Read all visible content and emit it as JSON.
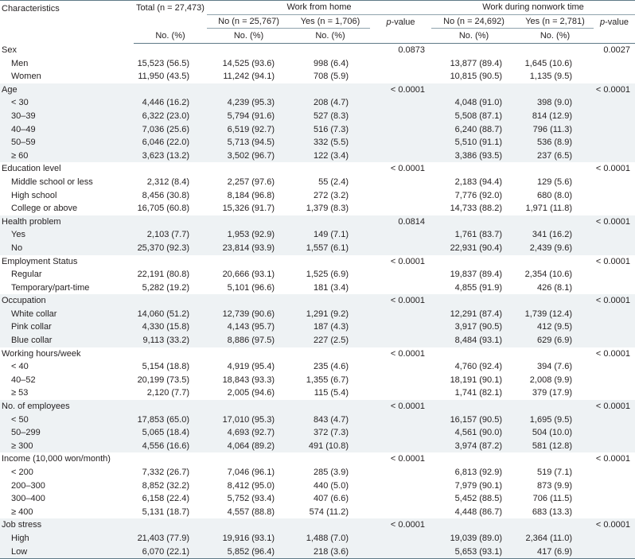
{
  "table": {
    "header": {
      "characteristics": "Characteristics",
      "total": "Total (n = 27,473)",
      "group_wfh": "Work from home",
      "group_wnt": "Work during nonwork time",
      "wfh_no": "No (n = 25,767)",
      "wfh_yes": "Yes (n = 1,706)",
      "wnt_no": "No (n = 24,692)",
      "wnt_yes": "Yes (n = 2,781)",
      "pvalue_1_prefix": "p",
      "pvalue_1_suffix": "-value",
      "pvalue_2_prefix": "p",
      "pvalue_2_suffix": "-value",
      "unit_total": "No. (%)",
      "unit_wfh_no": "No. (%)",
      "unit_wfh_yes": "No. (%)",
      "unit_wnt_no": "No. (%)",
      "unit_wnt_yes": "No. (%)"
    },
    "rows": [
      {
        "type": "group",
        "shaded": false,
        "label": "Sex",
        "total": "",
        "wfh_no": "",
        "wfh_yes": "",
        "p1": "0.0873",
        "wnt_no": "",
        "wnt_yes": "",
        "p2": "0.0027"
      },
      {
        "type": "item",
        "shaded": false,
        "label": "Men",
        "total": "15,523 (56.5)",
        "wfh_no": "14,525 (93.6)",
        "wfh_yes": "998 (6.4)",
        "p1": "",
        "wnt_no": "13,877 (89.4)",
        "wnt_yes": "1,645 (10.6)",
        "p2": ""
      },
      {
        "type": "item",
        "shaded": false,
        "label": "Women",
        "total": "11,950 (43.5)",
        "wfh_no": "11,242 (94.1)",
        "wfh_yes": "708 (5.9)",
        "p1": "",
        "wnt_no": "10,815 (90.5)",
        "wnt_yes": "1,135 (9.5)",
        "p2": ""
      },
      {
        "type": "group",
        "shaded": true,
        "label": "Age",
        "total": "",
        "wfh_no": "",
        "wfh_yes": "",
        "p1": "< 0.0001",
        "wnt_no": "",
        "wnt_yes": "",
        "p2": "< 0.0001"
      },
      {
        "type": "item",
        "shaded": true,
        "label": "< 30",
        "total": "4,446 (16.2)",
        "wfh_no": "4,239 (95.3)",
        "wfh_yes": "208 (4.7)",
        "p1": "",
        "wnt_no": "4,048 (91.0)",
        "wnt_yes": "398 (9.0)",
        "p2": ""
      },
      {
        "type": "item",
        "shaded": true,
        "label": "30–39",
        "total": "6,322 (23.0)",
        "wfh_no": "5,794 (91.6)",
        "wfh_yes": "527 (8.3)",
        "p1": "",
        "wnt_no": "5,508 (87.1)",
        "wnt_yes": "814 (12.9)",
        "p2": ""
      },
      {
        "type": "item",
        "shaded": true,
        "label": "40–49",
        "total": "7,036 (25.6)",
        "wfh_no": "6,519 (92.7)",
        "wfh_yes": "516 (7.3)",
        "p1": "",
        "wnt_no": "6,240 (88.7)",
        "wnt_yes": "796 (11.3)",
        "p2": ""
      },
      {
        "type": "item",
        "shaded": true,
        "label": "50–59",
        "total": "6,046 (22.0)",
        "wfh_no": "5,713 (94.5)",
        "wfh_yes": "332 (5.5)",
        "p1": "",
        "wnt_no": "5,510 (91.1)",
        "wnt_yes": "536 (8.9)",
        "p2": ""
      },
      {
        "type": "item",
        "shaded": true,
        "label": "≥ 60",
        "total": "3,623 (13.2)",
        "wfh_no": "3,502 (96.7)",
        "wfh_yes": "122 (3.4)",
        "p1": "",
        "wnt_no": "3,386 (93.5)",
        "wnt_yes": "237 (6.5)",
        "p2": ""
      },
      {
        "type": "group",
        "shaded": false,
        "label": "Education level",
        "total": "",
        "wfh_no": "",
        "wfh_yes": "",
        "p1": "< 0.0001",
        "wnt_no": "",
        "wnt_yes": "",
        "p2": "< 0.0001"
      },
      {
        "type": "item",
        "shaded": false,
        "label": "Middle school or less",
        "total": "2,312 (8.4)",
        "wfh_no": "2,257 (97.6)",
        "wfh_yes": "55 (2.4)",
        "p1": "",
        "wnt_no": "2,183 (94.4)",
        "wnt_yes": "129 (5.6)",
        "p2": ""
      },
      {
        "type": "item",
        "shaded": false,
        "label": "High school",
        "total": "8,456 (30.8)",
        "wfh_no": "8,184 (96.8)",
        "wfh_yes": "272 (3.2)",
        "p1": "",
        "wnt_no": "7,776 (92.0)",
        "wnt_yes": "680 (8.0)",
        "p2": ""
      },
      {
        "type": "item",
        "shaded": false,
        "label": "College or above",
        "total": "16,705 (60.8)",
        "wfh_no": "15,326 (91.7)",
        "wfh_yes": "1,379 (8.3)",
        "p1": "",
        "wnt_no": "14,733 (88.2)",
        "wnt_yes": "1,971 (11.8)",
        "p2": ""
      },
      {
        "type": "group",
        "shaded": true,
        "label": "Health problem",
        "total": "",
        "wfh_no": "",
        "wfh_yes": "",
        "p1": "0.0814",
        "wnt_no": "",
        "wnt_yes": "",
        "p2": "< 0.0001"
      },
      {
        "type": "item",
        "shaded": true,
        "label": "Yes",
        "total": "2,103 (7.7)",
        "wfh_no": "1,953 (92.9)",
        "wfh_yes": "149 (7.1)",
        "p1": "",
        "wnt_no": "1,761 (83.7)",
        "wnt_yes": "341 (16.2)",
        "p2": ""
      },
      {
        "type": "item",
        "shaded": true,
        "label": "No",
        "total": "25,370 (92.3)",
        "wfh_no": "23,814 (93.9)",
        "wfh_yes": "1,557 (6.1)",
        "p1": "",
        "wnt_no": "22,931 (90.4)",
        "wnt_yes": "2,439 (9.6)",
        "p2": ""
      },
      {
        "type": "group",
        "shaded": false,
        "label": "Employment Status",
        "total": "",
        "wfh_no": "",
        "wfh_yes": "",
        "p1": "< 0.0001",
        "wnt_no": "",
        "wnt_yes": "",
        "p2": "< 0.0001"
      },
      {
        "type": "item",
        "shaded": false,
        "label": "Regular",
        "total": "22,191 (80.8)",
        "wfh_no": "20,666 (93.1)",
        "wfh_yes": "1,525 (6.9)",
        "p1": "",
        "wnt_no": "19,837 (89.4)",
        "wnt_yes": "2,354 (10.6)",
        "p2": ""
      },
      {
        "type": "item",
        "shaded": false,
        "label": "Temporary/part-time",
        "total": "5,282 (19.2)",
        "wfh_no": "5,101 (96.6)",
        "wfh_yes": "181 (3.4)",
        "p1": "",
        "wnt_no": "4,855 (91.9)",
        "wnt_yes": "426 (8.1)",
        "p2": ""
      },
      {
        "type": "group",
        "shaded": true,
        "label": "Occupation",
        "total": "",
        "wfh_no": "",
        "wfh_yes": "",
        "p1": "< 0.0001",
        "wnt_no": "",
        "wnt_yes": "",
        "p2": "< 0.0001"
      },
      {
        "type": "item",
        "shaded": true,
        "label": "White collar",
        "total": "14,060 (51.2)",
        "wfh_no": "12,739 (90.6)",
        "wfh_yes": "1,291 (9.2)",
        "p1": "",
        "wnt_no": "12,291 (87.4)",
        "wnt_yes": "1,739 (12.4)",
        "p2": ""
      },
      {
        "type": "item",
        "shaded": true,
        "label": "Pink collar",
        "total": "4,330 (15.8)",
        "wfh_no": "4,143 (95.7)",
        "wfh_yes": "187 (4.3)",
        "p1": "",
        "wnt_no": "3,917 (90.5)",
        "wnt_yes": "412 (9.5)",
        "p2": ""
      },
      {
        "type": "item",
        "shaded": true,
        "label": "Blue collar",
        "total": "9,113 (33.2)",
        "wfh_no": "8,886 (97.5)",
        "wfh_yes": "227 (2.5)",
        "p1": "",
        "wnt_no": "8,484 (93.1)",
        "wnt_yes": "629 (6.9)",
        "p2": ""
      },
      {
        "type": "group",
        "shaded": false,
        "label": "Working hours/week",
        "total": "",
        "wfh_no": "",
        "wfh_yes": "",
        "p1": "< 0.0001",
        "wnt_no": "",
        "wnt_yes": "",
        "p2": "< 0.0001"
      },
      {
        "type": "item",
        "shaded": false,
        "label": "< 40",
        "total": "5,154 (18.8)",
        "wfh_no": "4,919 (95.4)",
        "wfh_yes": "235 (4.6)",
        "p1": "",
        "wnt_no": "4,760 (92.4)",
        "wnt_yes": "394 (7.6)",
        "p2": ""
      },
      {
        "type": "item",
        "shaded": false,
        "label": "40–52",
        "total": "20,199 (73.5)",
        "wfh_no": "18,843 (93.3)",
        "wfh_yes": "1,355 (6.7)",
        "p1": "",
        "wnt_no": "18,191 (90.1)",
        "wnt_yes": "2,008 (9.9)",
        "p2": ""
      },
      {
        "type": "item",
        "shaded": false,
        "label": "≥ 53",
        "total": "2,120 (7.7)",
        "wfh_no": "2,005 (94.6)",
        "wfh_yes": "115 (5.4)",
        "p1": "",
        "wnt_no": "1,741 (82.1)",
        "wnt_yes": "379 (17.9)",
        "p2": ""
      },
      {
        "type": "group",
        "shaded": true,
        "label": "No. of employees",
        "total": "",
        "wfh_no": "",
        "wfh_yes": "",
        "p1": "< 0.0001",
        "wnt_no": "",
        "wnt_yes": "",
        "p2": "< 0.0001"
      },
      {
        "type": "item",
        "shaded": true,
        "label": "< 50",
        "total": "17,853 (65.0)",
        "wfh_no": "17,010 (95.3)",
        "wfh_yes": "843 (4.7)",
        "p1": "",
        "wnt_no": "16,157 (90.5)",
        "wnt_yes": "1,695 (9.5)",
        "p2": ""
      },
      {
        "type": "item",
        "shaded": true,
        "label": "50–299",
        "total": "5,065 (18.4)",
        "wfh_no": "4,693 (92.7)",
        "wfh_yes": "372 (7.3)",
        "p1": "",
        "wnt_no": "4,561 (90.0)",
        "wnt_yes": "504 (10.0)",
        "p2": ""
      },
      {
        "type": "item",
        "shaded": true,
        "label": "≥ 300",
        "total": "4,556 (16.6)",
        "wfh_no": "4,064 (89.2)",
        "wfh_yes": "491 (10.8)",
        "p1": "",
        "wnt_no": "3,974 (87.2)",
        "wnt_yes": "581 (12.8)",
        "p2": ""
      },
      {
        "type": "group",
        "shaded": false,
        "label": "Income (10,000 won/month)",
        "total": "",
        "wfh_no": "",
        "wfh_yes": "",
        "p1": "< 0.0001",
        "wnt_no": "",
        "wnt_yes": "",
        "p2": "< 0.0001"
      },
      {
        "type": "item",
        "shaded": false,
        "label": "< 200",
        "total": "7,332 (26.7)",
        "wfh_no": "7,046 (96.1)",
        "wfh_yes": "285 (3.9)",
        "p1": "",
        "wnt_no": "6,813 (92.9)",
        "wnt_yes": "519 (7.1)",
        "p2": ""
      },
      {
        "type": "item",
        "shaded": false,
        "label": "200–300",
        "total": "8,852 (32.2)",
        "wfh_no": "8,412 (95.0)",
        "wfh_yes": "440 (5.0)",
        "p1": "",
        "wnt_no": "7,979 (90.1)",
        "wnt_yes": "873 (9.9)",
        "p2": ""
      },
      {
        "type": "item",
        "shaded": false,
        "label": "300–400",
        "total": "6,158 (22.4)",
        "wfh_no": "5,752 (93.4)",
        "wfh_yes": "407 (6.6)",
        "p1": "",
        "wnt_no": "5,452 (88.5)",
        "wnt_yes": "706 (11.5)",
        "p2": ""
      },
      {
        "type": "item",
        "shaded": false,
        "label": "≥ 400",
        "total": "5,131 (18.7)",
        "wfh_no": "4,557 (88.8)",
        "wfh_yes": "574 (11.2)",
        "p1": "",
        "wnt_no": "4,448 (86.7)",
        "wnt_yes": "683 (13.3)",
        "p2": ""
      },
      {
        "type": "group",
        "shaded": true,
        "label": "Job stress",
        "total": "",
        "wfh_no": "",
        "wfh_yes": "",
        "p1": "< 0.0001",
        "wnt_no": "",
        "wnt_yes": "",
        "p2": "< 0.0001"
      },
      {
        "type": "item",
        "shaded": true,
        "label": "High",
        "total": "21,403 (77.9)",
        "wfh_no": "19,916 (93.1)",
        "wfh_yes": "1,488 (7.0)",
        "p1": "",
        "wnt_no": "19,039 (89.0)",
        "wnt_yes": "2,364 (11.0)",
        "p2": ""
      },
      {
        "type": "item",
        "shaded": true,
        "label": "Low",
        "total": "6,070 (22.1)",
        "wfh_no": "5,852 (96.4)",
        "wfh_yes": "218 (3.6)",
        "p1": "",
        "wnt_no": "5,653 (93.1)",
        "wnt_yes": "417 (6.9)",
        "p2": ""
      }
    ]
  },
  "colors": {
    "rule": "#5f7a87",
    "shade": "#eef2f4",
    "text": "#231f20"
  }
}
